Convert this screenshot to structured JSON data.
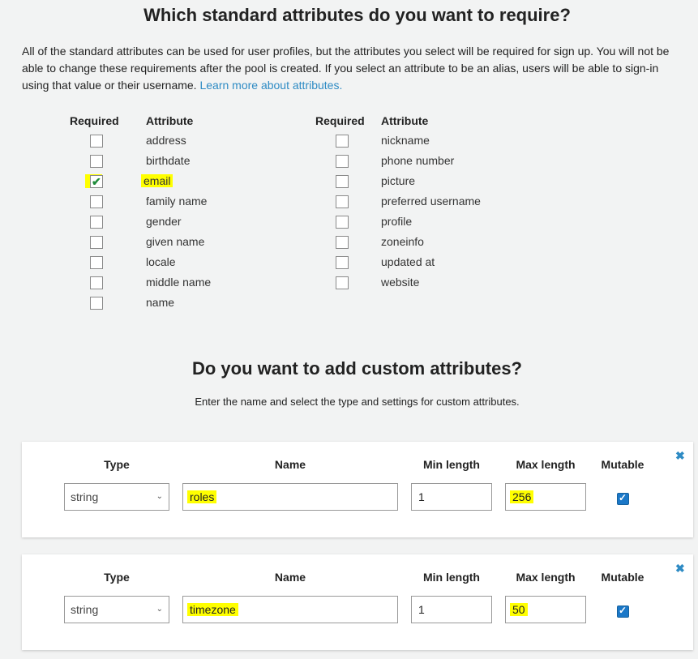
{
  "standard": {
    "title": "Which standard attributes do you want to require?",
    "intro_text": "All of the standard attributes can be used for user profiles, but the attributes you select will be required for sign up. You will not be able to change these requirements after the pool is created. If you select an attribute to be an alias, users will be able to sign-in using that value or their username.",
    "learn_more_link": "Learn more about attributes.",
    "col_required": "Required",
    "col_attribute": "Attribute",
    "left_attributes": [
      {
        "label": "address",
        "checked": false
      },
      {
        "label": "birthdate",
        "checked": false
      },
      {
        "label": "email",
        "checked": true
      },
      {
        "label": "family name",
        "checked": false
      },
      {
        "label": "gender",
        "checked": false
      },
      {
        "label": "given name",
        "checked": false
      },
      {
        "label": "locale",
        "checked": false
      },
      {
        "label": "middle name",
        "checked": false
      },
      {
        "label": "name",
        "checked": false
      }
    ],
    "right_attributes": [
      {
        "label": "nickname",
        "checked": false
      },
      {
        "label": "phone number",
        "checked": false
      },
      {
        "label": "picture",
        "checked": false
      },
      {
        "label": "preferred username",
        "checked": false
      },
      {
        "label": "profile",
        "checked": false
      },
      {
        "label": "zoneinfo",
        "checked": false
      },
      {
        "label": "updated at",
        "checked": false
      },
      {
        "label": "website",
        "checked": false
      }
    ]
  },
  "custom": {
    "title": "Do you want to add custom attributes?",
    "subtitle": "Enter the name and select the type and settings for custom attributes.",
    "col_type": "Type",
    "col_name": "Name",
    "col_min": "Min length",
    "col_max": "Max length",
    "col_mutable": "Mutable",
    "remove_icon": "close-icon",
    "rows": [
      {
        "type": "string",
        "name": "roles",
        "min": "1",
        "max": "256",
        "mutable": true
      },
      {
        "type": "string",
        "name": "timezone",
        "min": "1",
        "max": "50",
        "mutable": true
      }
    ]
  },
  "colors": {
    "link": "#2e8bc4",
    "highlight": "#ffff00",
    "checkbox_checked": "#1b78c8",
    "check_green": "#1f8c3b"
  }
}
